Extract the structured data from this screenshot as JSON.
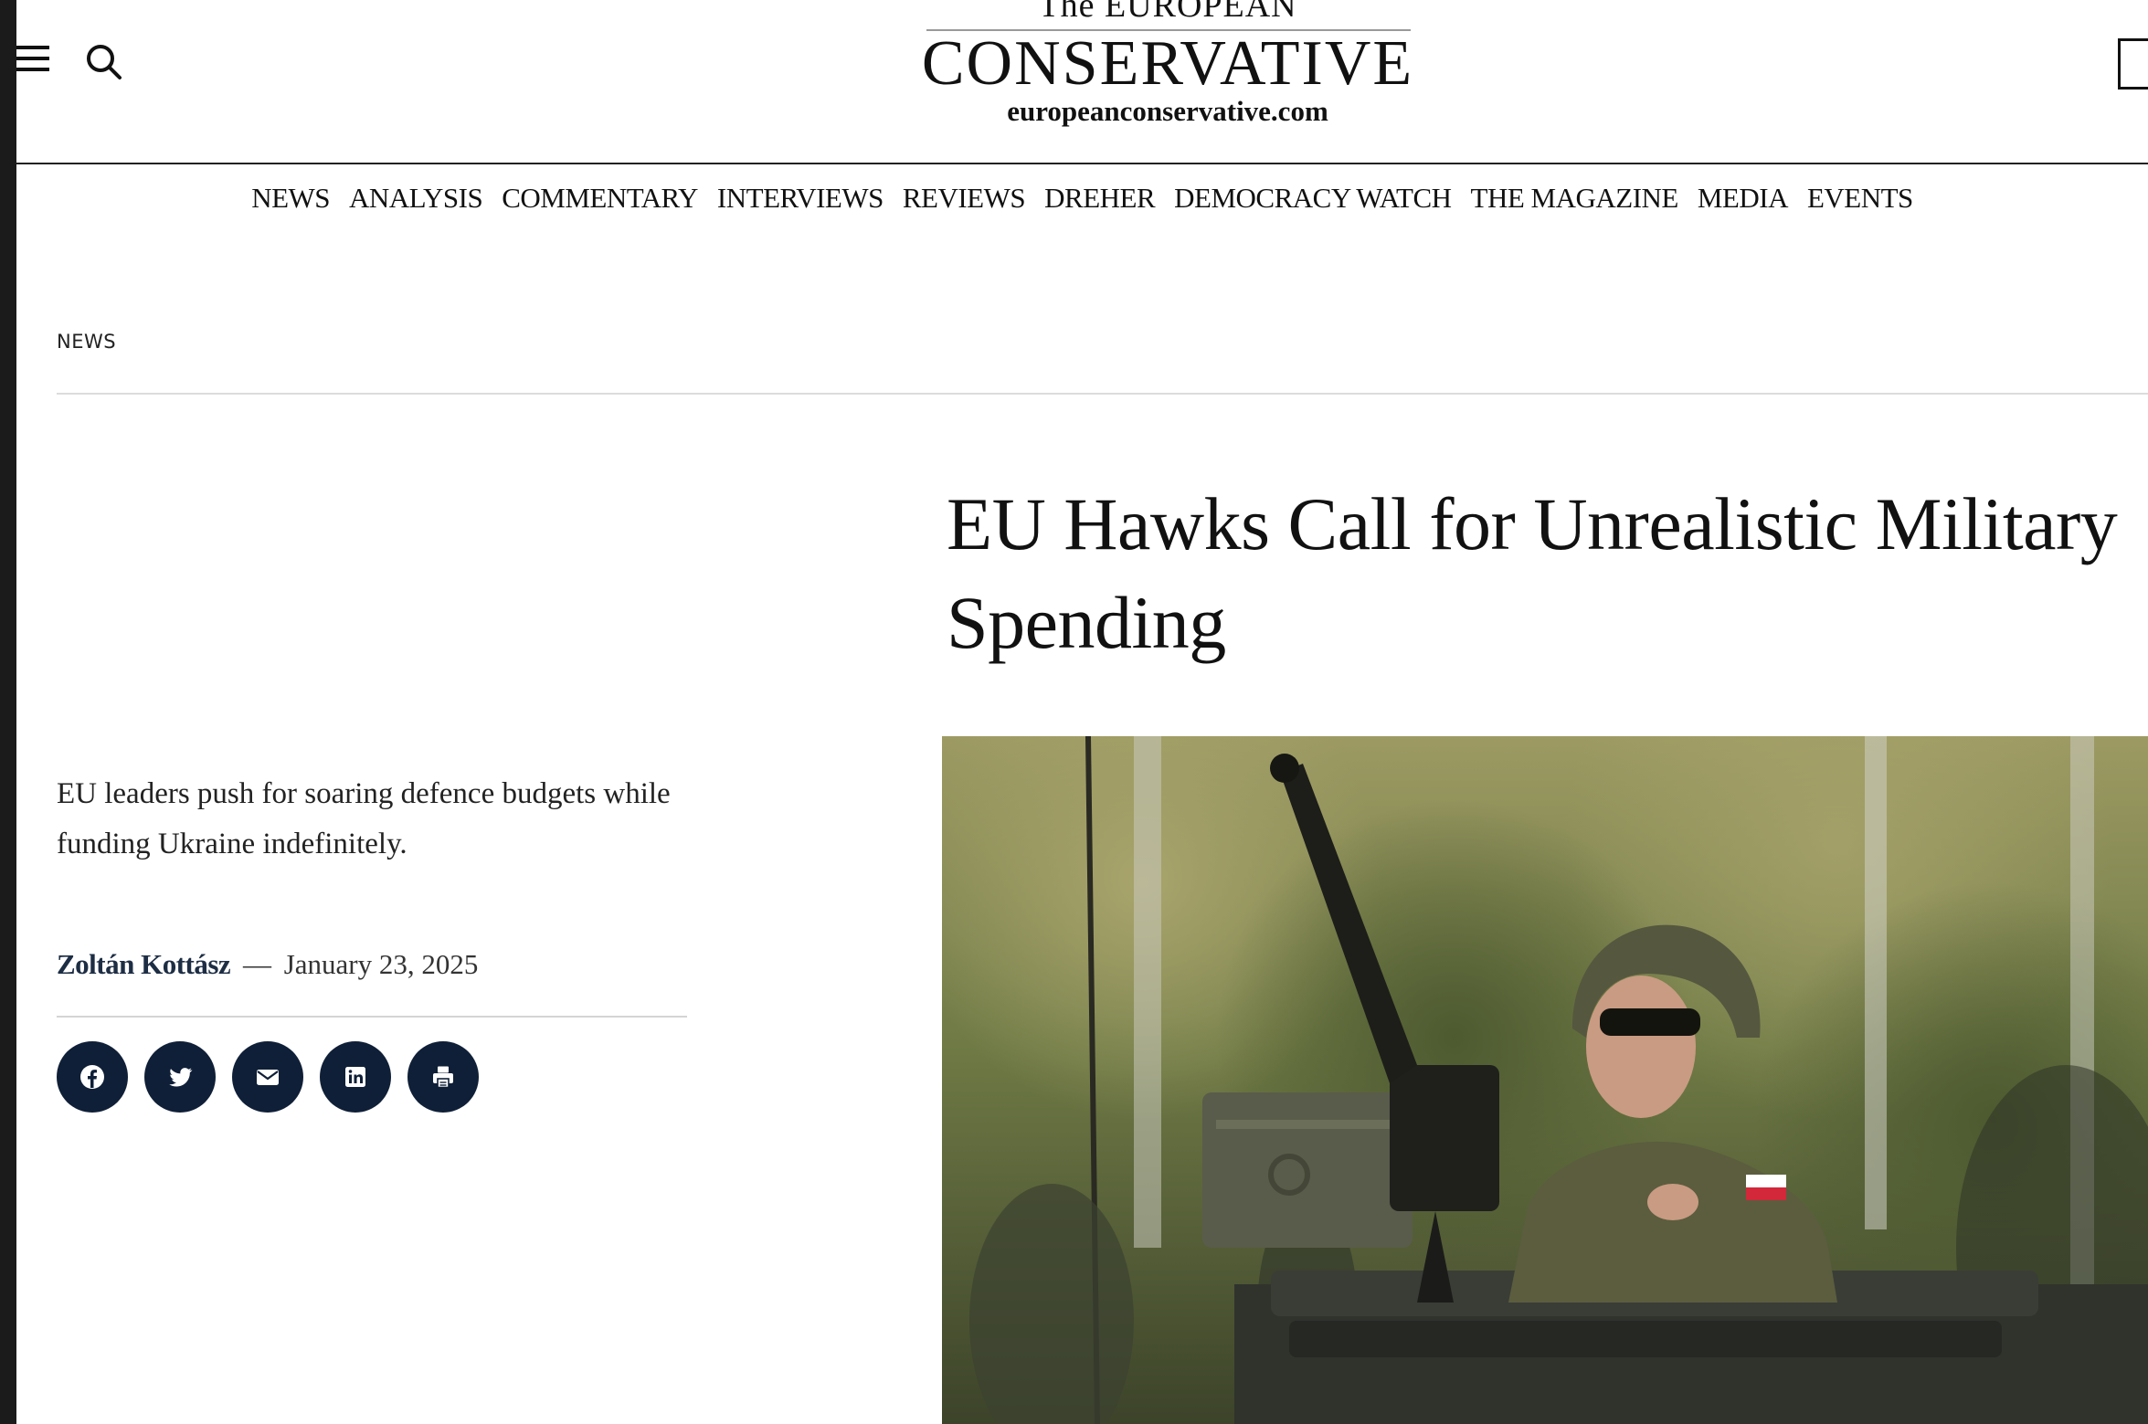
{
  "header": {
    "logo_top": "The EUROPEAN",
    "logo_main": "CONSERVATIVE",
    "logo_url": "europeanconservative.com"
  },
  "nav": {
    "items": [
      "NEWS",
      "ANALYSIS",
      "COMMENTARY",
      "INTERVIEWS",
      "REVIEWS",
      "DREHER",
      "DEMOCRACY WATCH",
      "THE MAGAZINE",
      "MEDIA",
      "EVENTS"
    ]
  },
  "breadcrumb": "NEWS",
  "article": {
    "title": "EU Hawks Call for Unrealistic Military Spending",
    "subtitle": "EU leaders push for soaring defence budgets while funding Ukraine indefinitely.",
    "author": "Zoltán Kottász",
    "separator": "—",
    "date": "January 23, 2025"
  },
  "share": {
    "icons": [
      "facebook-icon",
      "twitter-icon",
      "email-icon",
      "linkedin-icon",
      "print-icon"
    ]
  },
  "colors": {
    "accent": "#0f1f37",
    "text": "#111111",
    "rule": "#dcdcdc"
  }
}
